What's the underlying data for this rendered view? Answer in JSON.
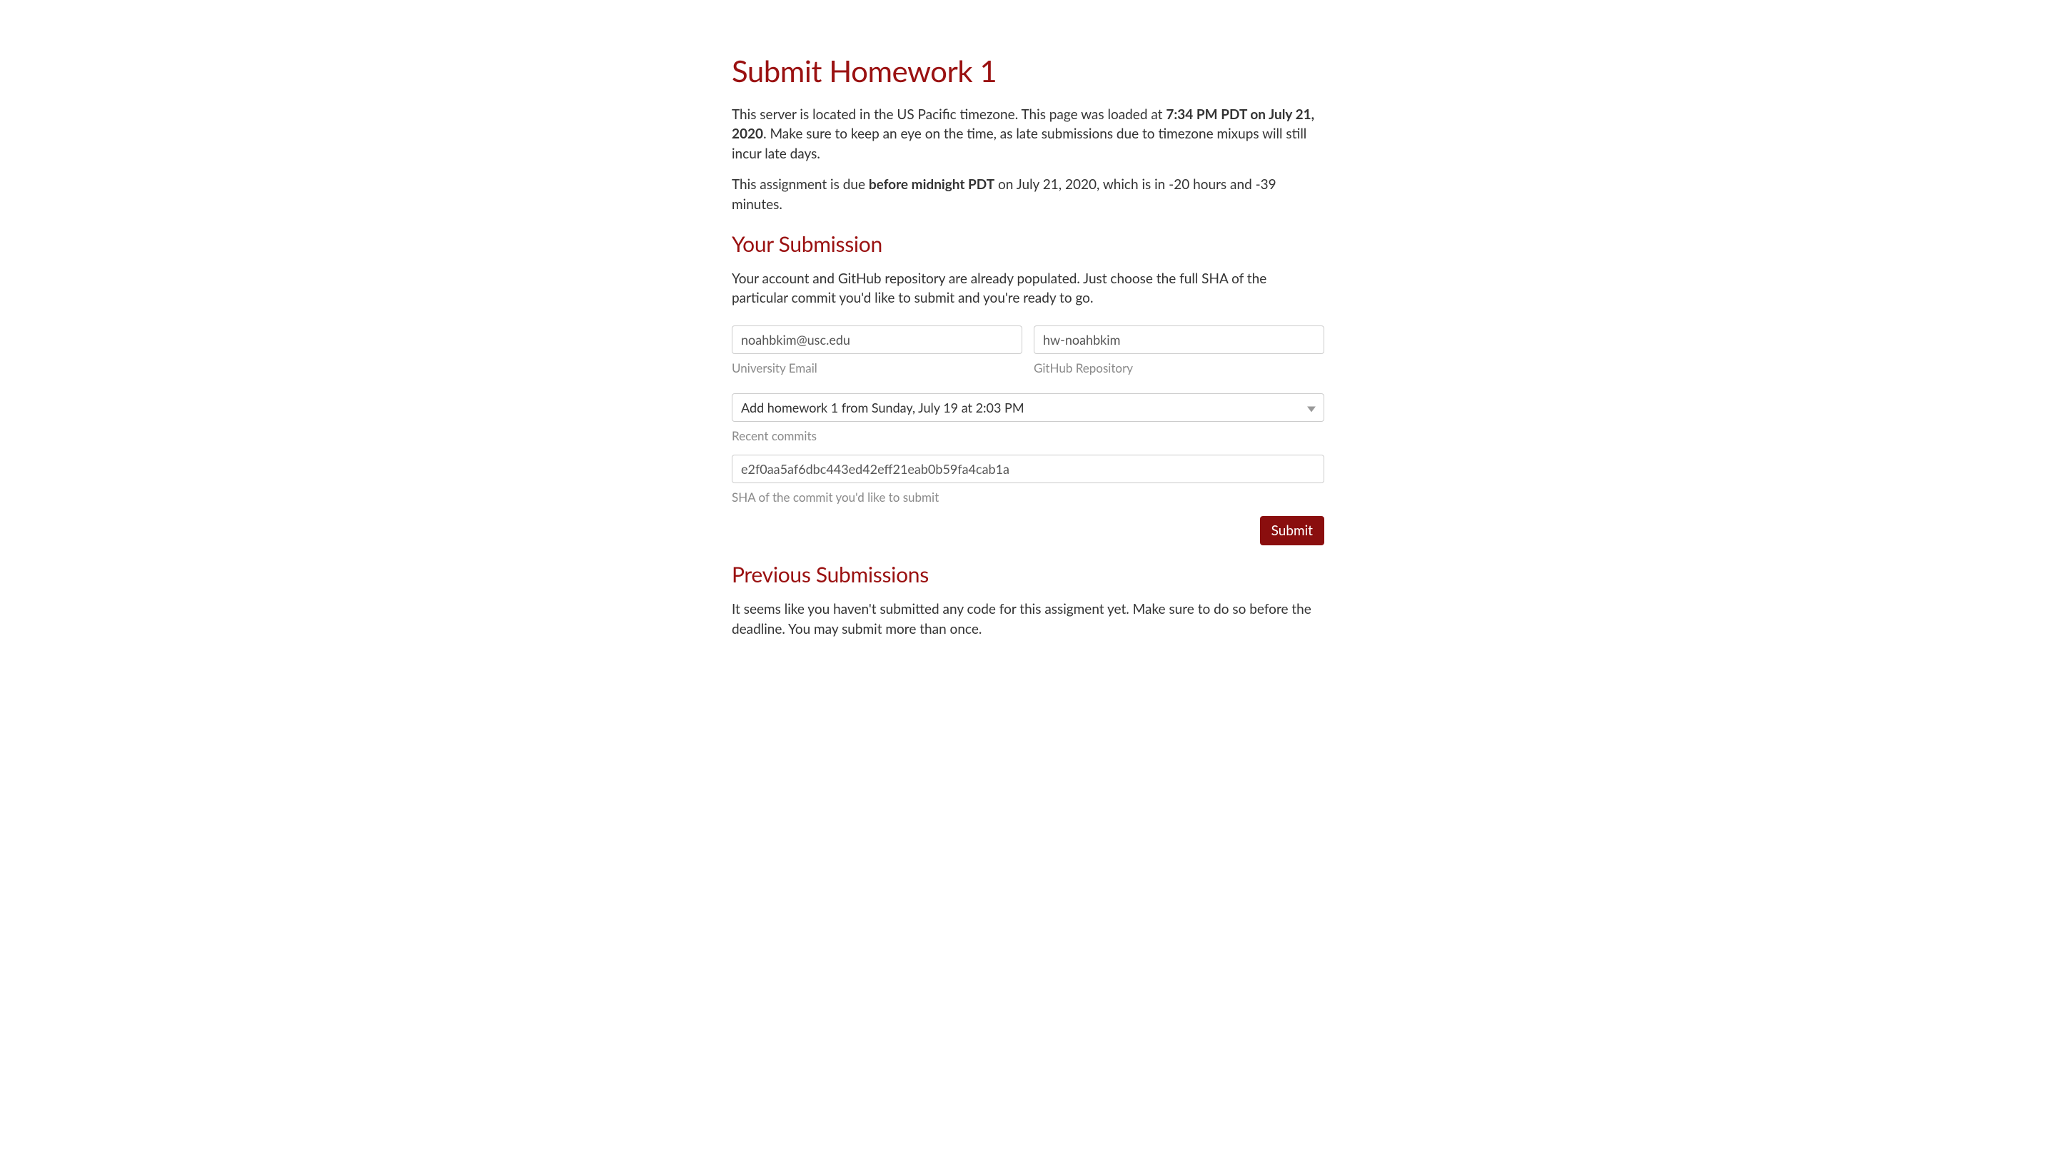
{
  "page_title": "Submit Homework 1",
  "timezone_notice": {
    "prefix": "This server is located in the US Pacific timezone. This page was loaded at ",
    "timestamp": "7:34 PM PDT on July 21, 2020",
    "suffix": ". Make sure to keep an eye on the time, as late submissions due to timezone mixups will still incur late days."
  },
  "due_notice": {
    "prefix": "This assignment is due ",
    "deadline": "before midnight PDT",
    "suffix": " on July 21, 2020, which is in -20 hours and -39 minutes."
  },
  "your_submission": {
    "heading": "Your Submission",
    "intro": "Your account and GitHub repository are already populated. Just choose the full SHA of the particular commit you'd like to submit and you're ready to go.",
    "email": {
      "value": "noahbkim@usc.edu",
      "label": "University Email"
    },
    "repo": {
      "value": "hw-noahbkim",
      "label": "GitHub Repository"
    },
    "commit_select": {
      "selected": "Add homework 1 from Sunday, July 19 at 2:03 PM",
      "label": "Recent commits"
    },
    "sha": {
      "value": "e2f0aa5af6dbc443ed42eff21eab0b59fa4cab1a",
      "label": "SHA of the commit you'd like to submit"
    },
    "submit_label": "Submit"
  },
  "previous": {
    "heading": "Previous Submissions",
    "text": "It seems like you haven't submitted any code for this assigment yet. Make sure to do so before the deadline. You may submit more than once."
  }
}
